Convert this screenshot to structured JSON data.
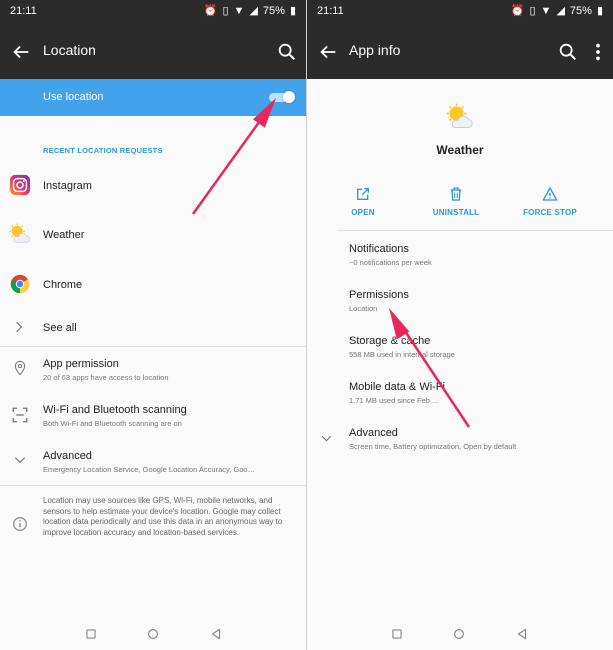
{
  "status_bar": {
    "time": "21:11",
    "battery": "75%"
  },
  "left": {
    "title": "Location",
    "toggle_row": {
      "label": "Use location",
      "on": true
    },
    "section_header": "RECENT LOCATION REQUESTS",
    "recent_apps": [
      {
        "label": "Instagram"
      },
      {
        "label": "Weather"
      },
      {
        "label": "Chrome"
      }
    ],
    "see_all": "See all",
    "settings": [
      {
        "title": "App permission",
        "subtitle": "20 of 63 apps have access to location"
      },
      {
        "title": "Wi-Fi and Bluetooth scanning",
        "subtitle": "Both Wi-Fi and Bluetooth scanning are on"
      },
      {
        "title": "Advanced",
        "subtitle": "Emergency Location Service, Google Location Accuracy, Goo…"
      }
    ],
    "info": "Location may use sources like GPS, Wi-Fi, mobile networks, and sensors to help estimate your device's location. Google may collect location data periodically and use this data in an anonymous way to improve location accuracy and location-based services."
  },
  "right": {
    "title": "App info",
    "app_name": "Weather",
    "actions": [
      {
        "label": "OPEN",
        "icon": "open-external-icon"
      },
      {
        "label": "UNINSTALL",
        "icon": "trash-icon"
      },
      {
        "label": "FORCE STOP",
        "icon": "warning-icon"
      }
    ],
    "items": [
      {
        "title": "Notifications",
        "subtitle": "~0 notifications per week"
      },
      {
        "title": "Permissions",
        "subtitle": "Location"
      },
      {
        "title": "Storage & cache",
        "subtitle": "558 MB used in internal storage"
      },
      {
        "title": "Mobile data & Wi-Fi",
        "subtitle": "1.71 MB used since Feb ..."
      },
      {
        "title": "Advanced",
        "subtitle": "Screen time, Battery optimization, Open by default"
      }
    ]
  },
  "colors": {
    "accent": "#2a9bd6",
    "toggle_row_bg": "#42a2eb",
    "appbar_bg": "#2b2b2b",
    "arrow": "#e8275a"
  }
}
